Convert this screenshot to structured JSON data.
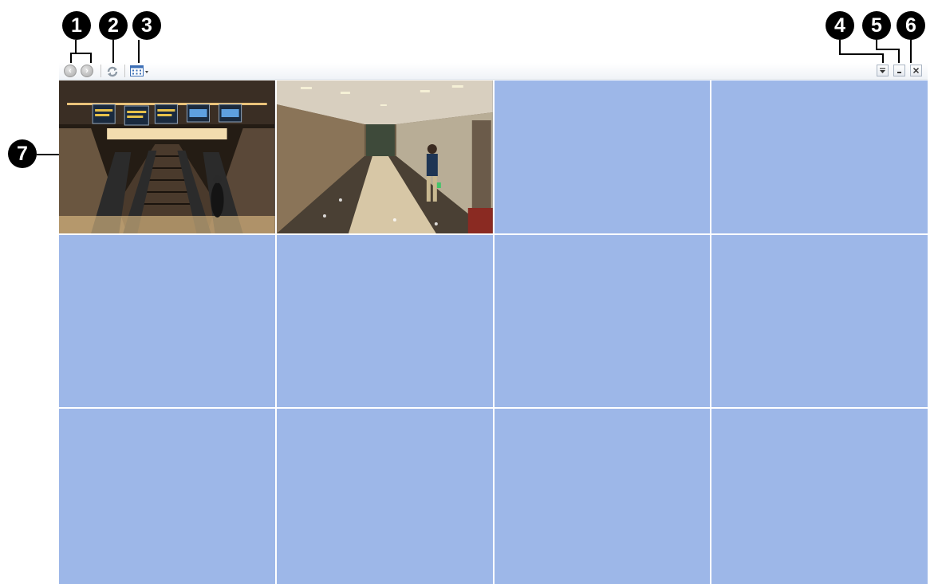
{
  "callouts": [
    "1",
    "2",
    "3",
    "4",
    "5",
    "6",
    "7"
  ],
  "toolbar": {
    "icons": [
      "back-arrow-icon",
      "forward-arrow-icon",
      "refresh-icon",
      "layout-grid-icon",
      "dropdown-menu-icon",
      "minimize-icon",
      "close-icon"
    ]
  },
  "grid": {
    "columns": 4,
    "rows_visible": 3,
    "empty_cell_color": "#9db7e8",
    "cells": [
      {
        "feed": "escalators"
      },
      {
        "feed": "corridor"
      },
      {
        "feed": "empty"
      },
      {
        "feed": "empty"
      },
      {
        "feed": "empty"
      },
      {
        "feed": "empty"
      },
      {
        "feed": "empty"
      },
      {
        "feed": "empty"
      },
      {
        "feed": "empty"
      },
      {
        "feed": "empty"
      },
      {
        "feed": "empty"
      },
      {
        "feed": "empty"
      }
    ]
  }
}
